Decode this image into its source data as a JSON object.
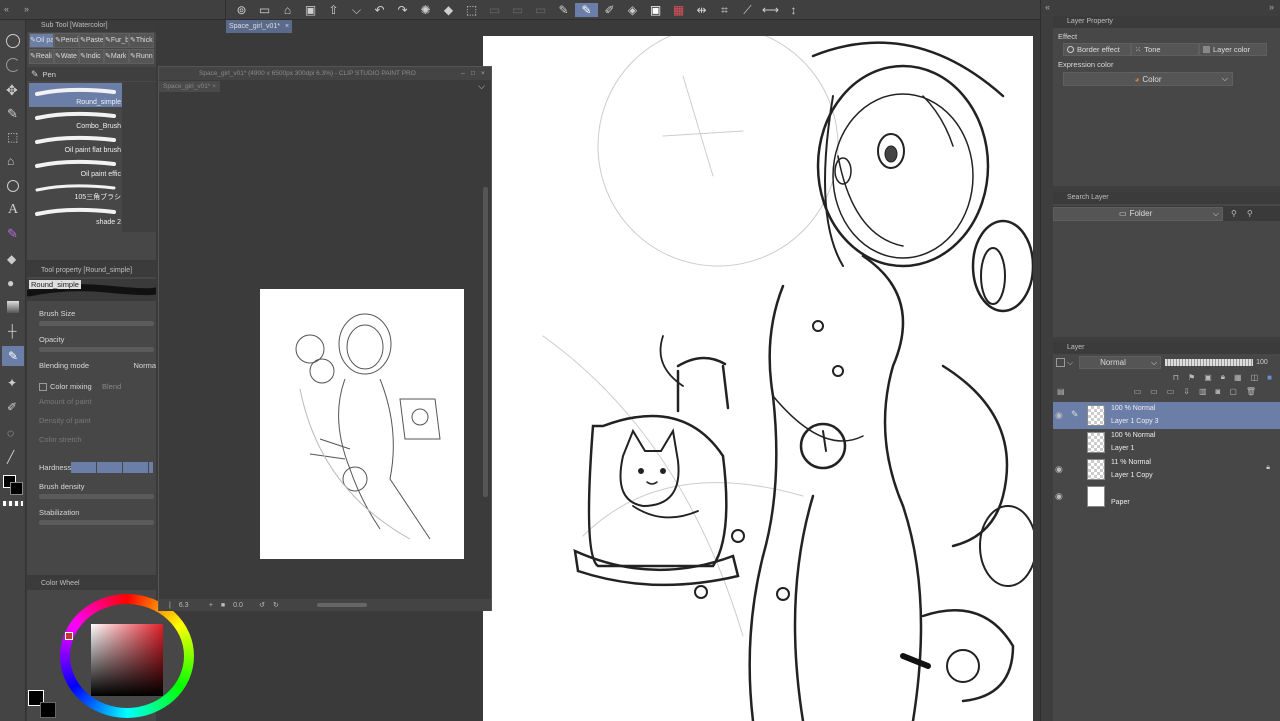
{
  "toolbar": {
    "icons": [
      "gear-icon",
      "new-file-icon",
      "open-icon",
      "save-icon",
      "upload-icon",
      "dropdown-icon",
      "undo-icon",
      "redo-icon",
      "clear-icon",
      "fill-icon",
      "transform-icon",
      "blank1",
      "blank2",
      "blank3",
      "pen-icon",
      "marker-icon",
      "pencil-icon",
      "eraser-icon",
      "correction-icon",
      "ruler-icon",
      "flip-h-icon",
      "grid-icon",
      "line-icon",
      "arrows-h-icon",
      "arrows-v-icon"
    ]
  },
  "subtool": {
    "header": "Sub Tool [Watercolor]",
    "tabs_row1": [
      "Oil pa",
      "Pencil",
      "Pastel",
      "Fur_b",
      "Thick"
    ],
    "tabs_row2": [
      "Reali",
      "Wate",
      "Indic",
      "Mark",
      "Runn"
    ],
    "group_label": "Pen",
    "brushes": [
      "Round_simple",
      "Combo_Brush",
      "Oil paint flat brush",
      "Oil paint effic",
      "105三角ブラシ",
      "shade 2"
    ]
  },
  "toolprop": {
    "header": "Tool property [Round_simple]",
    "brush_name": "Round_simple",
    "brush_size": "Brush Size",
    "opacity": "Opacity",
    "blending_mode": "Blending mode",
    "blending_value": "Norma",
    "color_mixing": "Color mixing",
    "blend": "Blend",
    "amount_of_paint": "Amount of paint",
    "density_of_paint": "Density of paint",
    "color_stretch": "Color stretch",
    "hardness": "Hardness",
    "brush_density": "Brush density",
    "stabilization": "Stabilization"
  },
  "colorwheel": {
    "header": "Color Wheel",
    "accent": "#c0392b"
  },
  "tabs": {
    "main_tab": "Space_girl_v01*"
  },
  "navigator": {
    "title": "Space_girl_v01* (4900 x 6500px 300dpi 6.3%) - CLIP STUDIO PAINT PRO",
    "tab": "Space_girl_v01*",
    "zoom": "6.3",
    "angle": "0.0"
  },
  "layerprop": {
    "header": "Layer Property",
    "effect": "Effect",
    "border_effect": "Border effect",
    "tone": "Tone",
    "layer_color": "Layer color",
    "expression_color": "Expression color",
    "color": "Color"
  },
  "searchlayer": {
    "header": "Search Layer",
    "folder": "Folder"
  },
  "layers": {
    "header": "Layer",
    "blend_mode": "Normal",
    "opacity": "100",
    "items": [
      {
        "mode": "100 % Normal",
        "name": "Layer 1 Copy 3",
        "selected": true,
        "visible": true
      },
      {
        "mode": "100 % Normal",
        "name": "Layer 1",
        "selected": false,
        "visible": false
      },
      {
        "mode": "11 % Normal",
        "name": "Layer 1 Copy",
        "selected": false,
        "visible": true
      },
      {
        "mode": "",
        "name": "Paper",
        "selected": false,
        "visible": true
      }
    ]
  }
}
